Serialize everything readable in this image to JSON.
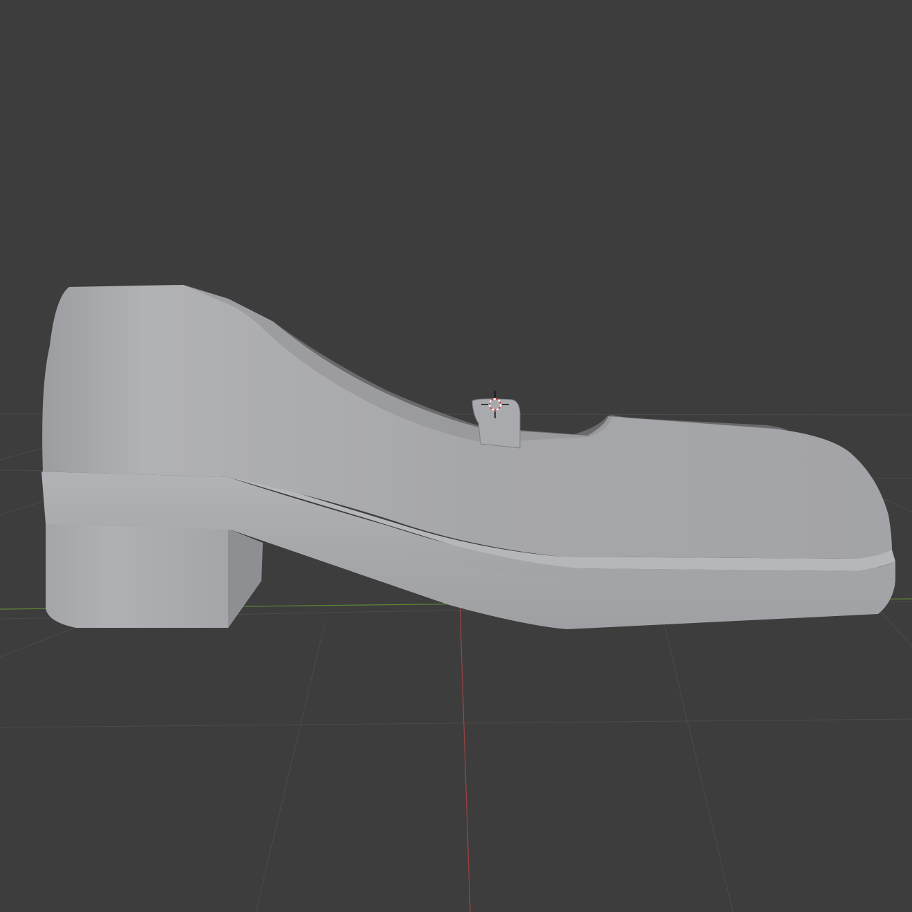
{
  "app": {
    "view": "3D viewport",
    "background_color": "#3d3d3d",
    "grid_color": "#4a4a4a",
    "axis_x_color": "#6f9a3e",
    "axis_y_color": "#b54a4a"
  },
  "scene": {
    "object": "shoe",
    "object_color": "#a7a8ab",
    "cursor_icon": "3d-cursor-icon"
  }
}
